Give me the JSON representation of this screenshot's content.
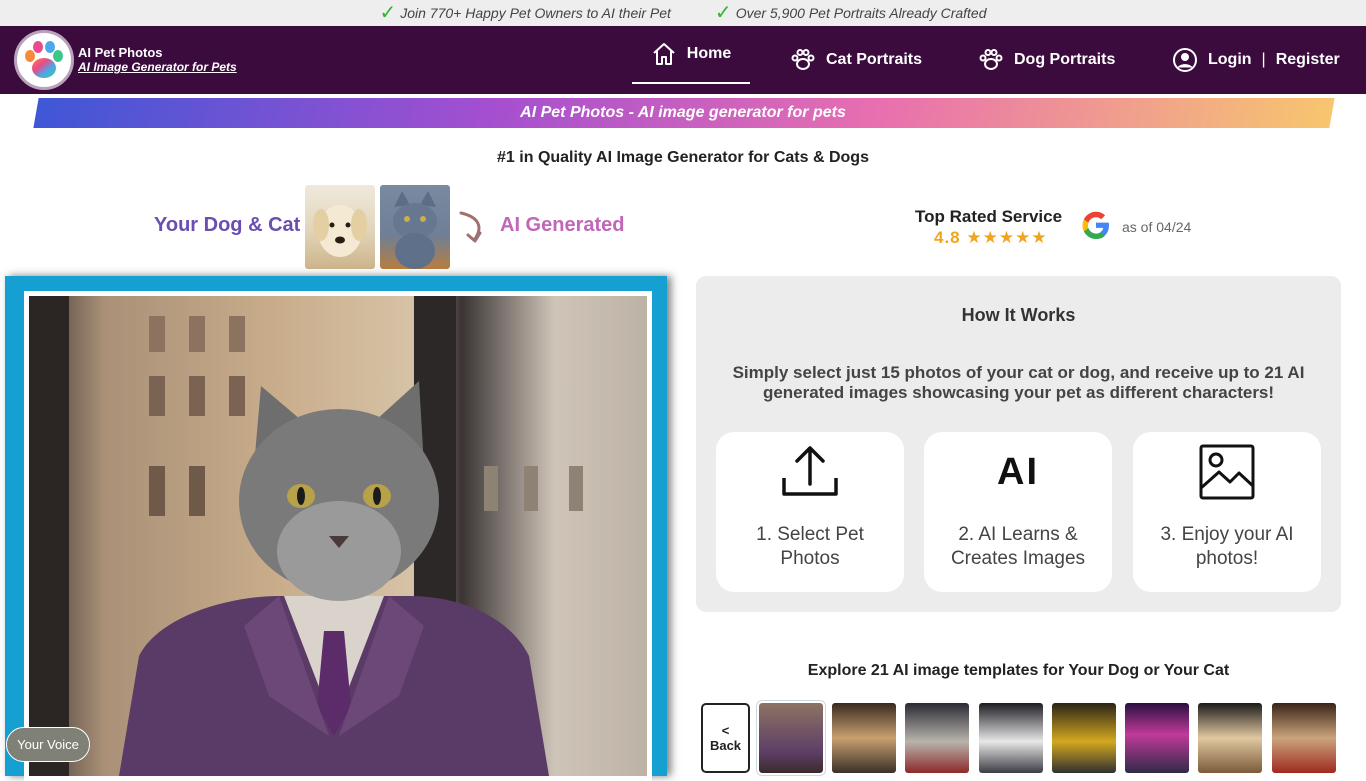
{
  "announce": {
    "items": [
      "Join 770+ Happy Pet Owners to AI their Pet",
      "Over 5,900 Pet Portraits Already Crafted"
    ]
  },
  "nav": {
    "brand_name": "AI Pet Photos",
    "brand_tagline": "AI Image Generator for Pets",
    "home": "Home",
    "cat_portraits": "Cat Portraits",
    "dog_portraits": "Dog Portraits",
    "login": "Login",
    "login_sep": "|",
    "register": "Register"
  },
  "banner": {
    "text": "AI Pet Photos - AI image generator for pets"
  },
  "headline": "#1 in Quality AI Image Generator for Cats & Dogs",
  "hero": {
    "your_pets": "Your Dog & Cat",
    "ai_generated": "AI Generated"
  },
  "rating": {
    "title": "Top Rated Service",
    "score": "4.8",
    "stars": "★★★★★",
    "star_value": 4.8,
    "as_of": "as of 04/24"
  },
  "how": {
    "title": "How It Works",
    "description": "Simply select just 15 photos of your cat or dog, and receive up to 21 AI generated images showcasing your pet as different characters!",
    "steps": [
      {
        "label": "1. Select Pet Photos",
        "icon": "upload-icon"
      },
      {
        "label": "2. AI Learns & Creates Images",
        "icon": "ai-icon",
        "mark": "AI"
      },
      {
        "label": "3. Enjoy your AI photos!",
        "icon": "image-icon"
      }
    ]
  },
  "explore": {
    "title": "Explore 21 AI image templates for Your Dog or Your Cat",
    "back_arrow": "<",
    "back_label": "Back"
  },
  "voice": {
    "label": "Your Voice"
  },
  "colors": {
    "nav_bg": "#3b0b3d",
    "frame": "#169fd1",
    "accent_purple": "#6a4fb0",
    "accent_pink": "#c166b8",
    "star": "#f2a51c"
  }
}
